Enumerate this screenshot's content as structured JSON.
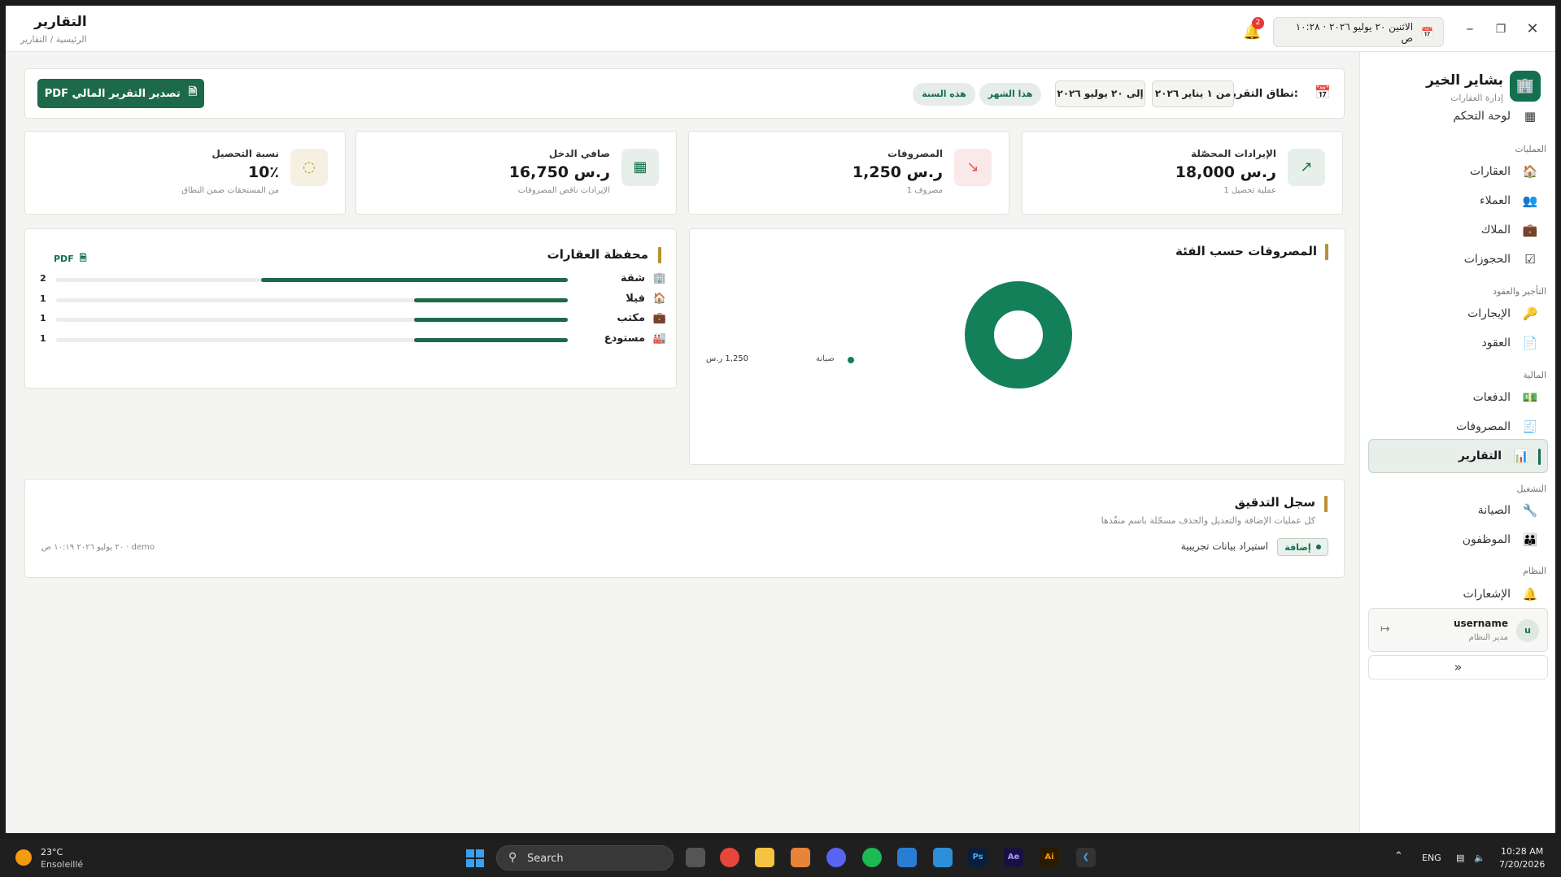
{
  "header": {
    "title": "التقارير",
    "breadcrumb": "الرئيسية / التقارير",
    "datetime": "الاثنين ٢٠ يوليو ٢٠٢٦ · ١٠:٢٨ ص",
    "notifications_count": "2"
  },
  "brand": {
    "name": "بشاير الخير",
    "subtitle": "إدارة العقارات"
  },
  "sidebar": {
    "dashboard": "لوحة التحكم",
    "sections": {
      "operations": "العمليات",
      "leasing": "التأجير والعقود",
      "finance": "المالية",
      "running": "التشغيل",
      "system": "النظام"
    },
    "items": {
      "properties": "العقارات",
      "clients": "العملاء",
      "owners": "الملاك",
      "bookings": "الحجوزات",
      "rentals": "الإيجارات",
      "contracts": "العقود",
      "payments": "الدفعات",
      "expenses": "المصروفات",
      "reports": "التقارير",
      "maintenance": "الصيانة",
      "employees": "الموظفون",
      "notifications": "الإشعارات"
    },
    "user": {
      "initial": "u",
      "name": "username",
      "role": "مدير النظام"
    },
    "collapse_label": "»"
  },
  "range": {
    "label": "نطاق التقرير:",
    "from": "من ١ يناير ٢٠٢٦",
    "to": "إلى ٢٠ يوليو ٢٠٢٦",
    "this_month": "هذا الشهر",
    "this_year": "هذه السنة",
    "export_label": "تصدير التقرير المالي PDF"
  },
  "stats": {
    "revenue": {
      "label": "الإيرادات المحصّلة",
      "value": "18,000 ر.س",
      "sub": "1 عملية تحصيل"
    },
    "expenses": {
      "label": "المصروفات",
      "value": "1,250 ر.س",
      "sub": "1 مصروف"
    },
    "net": {
      "label": "صافي الدخل",
      "value": "16,750 ر.س",
      "sub": "الإيرادات ناقص المصروفات"
    },
    "collection": {
      "label": "نسبة التحصيل",
      "value": "10٪",
      "sub": "من المستحقات ضمن النطاق"
    }
  },
  "portfolio": {
    "title": "محفظة العقارات",
    "pdf_label": "PDF",
    "max": 2,
    "rows": [
      {
        "name": "شقة",
        "count": 2
      },
      {
        "name": "فيلا",
        "count": 1
      },
      {
        "name": "مكتب",
        "count": 1
      },
      {
        "name": "مستودع",
        "count": 1
      }
    ]
  },
  "expenses_chart": {
    "title": "المصروفات حسب الفئة",
    "legend_name": "صيانة",
    "legend_value": "1,250 ر.س"
  },
  "chart_data": {
    "type": "pie",
    "title": "المصروفات حسب الفئة",
    "categories": [
      "صيانة"
    ],
    "values": [
      1250
    ],
    "colors": [
      "#13805a"
    ],
    "donut": true,
    "legend": "left"
  },
  "audit": {
    "title": "سجل التدقيق",
    "subtitle": "كل عمليات الإضافة والتعديل والحذف مسجّلة باسم منفّذها",
    "tag": "إضافة",
    "text": "استيراد بيانات تجريبية",
    "meta": "٢٠ يوليو ٢٠٢٦ ١٠:١٩ ص · demo"
  },
  "taskbar": {
    "temp": "23°C",
    "weather": "Ensoleillé",
    "search": "Search",
    "lang": "ENG",
    "time": "10:28 AM",
    "date": "7/20/2026"
  },
  "colors": {
    "primary": "#13704f",
    "accent": "#b8922f",
    "expense_red": "#e05555"
  }
}
